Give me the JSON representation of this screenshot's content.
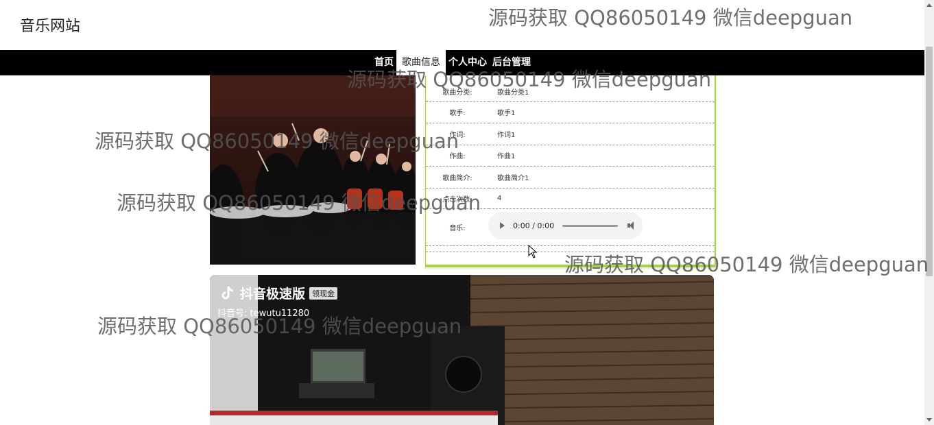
{
  "header": {
    "site_title": "音乐网站"
  },
  "nav": {
    "items": [
      {
        "label": "首页"
      },
      {
        "label": "歌曲信息",
        "active": true
      },
      {
        "label": "个人中心"
      },
      {
        "label": "后台管理"
      }
    ]
  },
  "song_info": {
    "rows": [
      {
        "label": "歌曲分类:",
        "value": "歌曲分类1"
      },
      {
        "label": "歌手:",
        "value": "歌手1"
      },
      {
        "label": "作词:",
        "value": "作词1"
      },
      {
        "label": "作曲:",
        "value": "作曲1"
      },
      {
        "label": "歌曲简介:",
        "value": "歌曲简介1"
      },
      {
        "label": "点击次数:",
        "value": "4"
      }
    ],
    "music_label": "音乐:"
  },
  "player": {
    "time": "0:00 / 0:00",
    "progress_fraction": 0,
    "play_icon": "play-icon",
    "volume_icon": "volume-icon"
  },
  "video": {
    "app_name": "抖音极速版",
    "badge": "领现金",
    "account": "抖音号: tewutu11280"
  },
  "watermarks": [
    "源码获取 QQ86050149 微信deepguan",
    "源码获取 QQ86050149 微信deepguan",
    "源码获取 QQ86050149 微信deepguan",
    "源码获取 QQ86050149 微信deepguan",
    "源码获取 QQ86050149 微信deepguan",
    "源码获取 QQ86050149 微信deepguan"
  ],
  "colors": {
    "navbar_bg": "#000000",
    "panel_accent": "#a8d04a",
    "player_bg": "#f1f3f4"
  }
}
